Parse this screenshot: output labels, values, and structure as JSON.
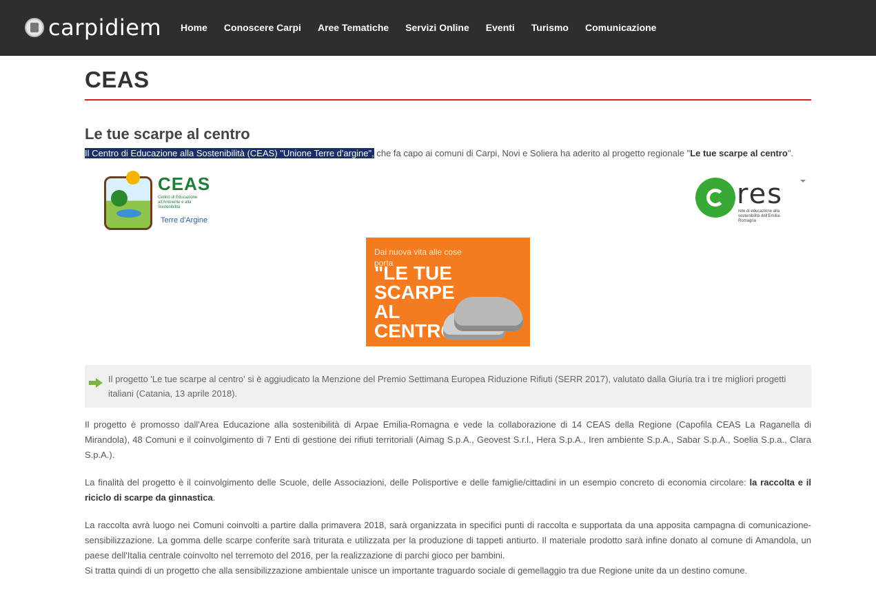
{
  "header": {
    "logo_text": "carpidiem",
    "nav": [
      "Home",
      "Conoscere Carpi",
      "Aree Tematiche",
      "Servizi Online",
      "Eventi",
      "Turismo",
      "Comunicazione"
    ]
  },
  "page": {
    "title": "CEAS",
    "section_title": "Le tue scarpe al centro",
    "intro": {
      "highlighted": "Il Centro di Educazione alla Sostenibilità (CEAS) \"Unione Terre d'argine\",",
      "text": " che fa capo ai comuni di Carpi, Novi e Soliera ha aderito al progetto regionale \"",
      "bold": "Le tue scarpe al centro",
      "end": "\"."
    },
    "logos": {
      "ceas_text": "CEAS",
      "ceas_sub": "Centro di Educazione all'Ambiente e alla Sostenibilità",
      "ceas_terre": "Terre d'Argine",
      "res_text": "res",
      "res_sub": "rete di educazione alla sostenibilità dell'Emilia-Romagna"
    },
    "poster": {
      "line1": "Dai nuova vita alle cose",
      "line2": "porta",
      "big": "\"LE TUE SCARPE AL CENTRO\""
    },
    "callout": "Il progetto 'Le tue scarpe al centro' si è aggiudicato la Menzione del Premio Settimana Europea Riduzione Rifiuti (SERR 2017), valutato dalla Giuria tra i tre migliori progetti italiani (Catania, 13 aprile 2018).",
    "para1": "Il progetto è promosso dall'Area Educazione alla sostenibilità di Arpae Emilia-Romagna e vede la collaborazione di 14 CEAS della Regione (Capofila CEAS La Raganella di Mirandola),  48 Comuni e il coinvolgimento di 7 Enti di gestione dei rifiuti territoriali (Aimag S.p.A., Geovest S.r.l., Hera S.p.A., Iren ambiente S.p.A., Sabar S.p.A., Soelia S.p.a., Clara S.p.A.).",
    "para2": {
      "text": "La finalità del progetto è il coinvolgimento delle Scuole, delle Associazioni, delle Polisportive e delle famiglie/cittadini in un esempio concreto di economia circolare: ",
      "bold": "la raccolta e il riciclo di scarpe da ginnastica",
      "end": "."
    },
    "para3": "La raccolta avrà luogo nei Comuni coinvolti a partire dalla primavera 2018, sarà organizzata in specifici punti di raccolta e supportata da una apposita campagna di comunicazione-sensibilizzazione. La gomma delle scarpe conferite sarà triturata e utilizzata per la produzione di tappeti antiurto. Il materiale prodotto sarà infine donato al comune di Amandola, un paese dell'Italia centrale coinvolto nel terremoto del 2016, per la realizzazione di parchi gioco per bambini.",
    "para4": "Si tratta quindi di un progetto che alla sensibilizzazione ambientale unisce un importante traguardo sociale di gemellaggio tra due Regione unite da un destino comune."
  }
}
